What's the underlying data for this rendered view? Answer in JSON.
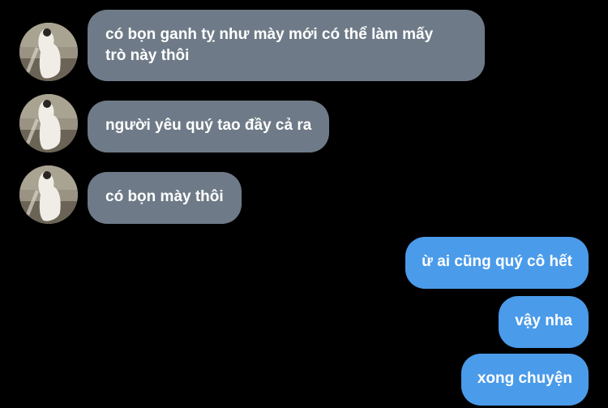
{
  "conversation": {
    "incoming": [
      {
        "lines": [
          "có bọn ganh tỵ như mày mới có thể làm mấy",
          "trò này thôi"
        ]
      },
      {
        "lines": [
          "người yêu quý tao đầy cả ra"
        ]
      },
      {
        "lines": [
          "có bọn mày thôi"
        ]
      }
    ],
    "outgoing": [
      {
        "text": "ừ ai cũng quý cô hết"
      },
      {
        "text": "vậy nha"
      },
      {
        "text": "xong chuyện"
      }
    ]
  },
  "colors": {
    "background": "#000000",
    "incoming_bubble": "#6e7a87",
    "outgoing_bubble": "#4a9bea",
    "text": "#ffffff"
  }
}
